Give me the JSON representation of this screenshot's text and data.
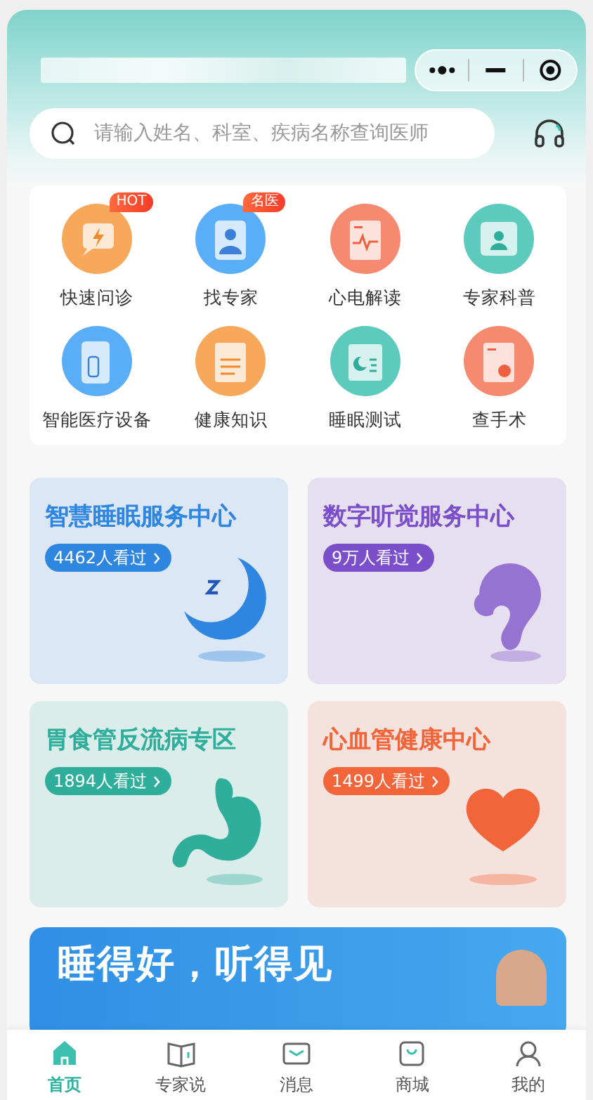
{
  "search": {
    "placeholder": "请输入姓名、科室、疾病名称查询医师"
  },
  "shortcuts": [
    {
      "label": "快速问诊",
      "badge": "HOT",
      "kind": "chat",
      "color": "#f7a85a"
    },
    {
      "label": "找专家",
      "badge": "名医",
      "kind": "doctor",
      "color": "#5aaef7"
    },
    {
      "label": "心电解读",
      "kind": "ecg",
      "color": "#f58a70"
    },
    {
      "label": "专家科普",
      "kind": "scan",
      "color": "#5ccabd"
    },
    {
      "label": "智能医疗设备",
      "kind": "device",
      "color": "#5aaef7"
    },
    {
      "label": "健康知识",
      "kind": "article",
      "color": "#f7a85a"
    },
    {
      "label": "睡眠测试",
      "kind": "sleep",
      "color": "#5ccabd"
    },
    {
      "label": "查手术",
      "kind": "report",
      "color": "#f58a70"
    }
  ],
  "service_cards": [
    {
      "title": "智慧睡眠服务中心",
      "views": "4462人看过",
      "kind": "moon",
      "color": "#2f86e0"
    },
    {
      "title": "数字听觉服务中心",
      "views": "9万人看过",
      "kind": "ear",
      "color": "#7b4fc9"
    },
    {
      "title": "胃食管反流病专区",
      "views": "1894人看过",
      "kind": "stomach",
      "color": "#2fae9b"
    },
    {
      "title": "心血管健康中心",
      "views": "1499人看过",
      "kind": "heart",
      "color": "#f2643a"
    }
  ],
  "banner": {
    "title": "睡得好，听得见"
  },
  "tabs": [
    {
      "label": "首页",
      "kind": "home",
      "selected": true
    },
    {
      "label": "专家说",
      "kind": "book",
      "selected": false
    },
    {
      "label": "消息",
      "kind": "message",
      "selected": false
    },
    {
      "label": "商城",
      "kind": "shop",
      "selected": false
    },
    {
      "label": "我的",
      "kind": "user",
      "selected": false
    }
  ]
}
